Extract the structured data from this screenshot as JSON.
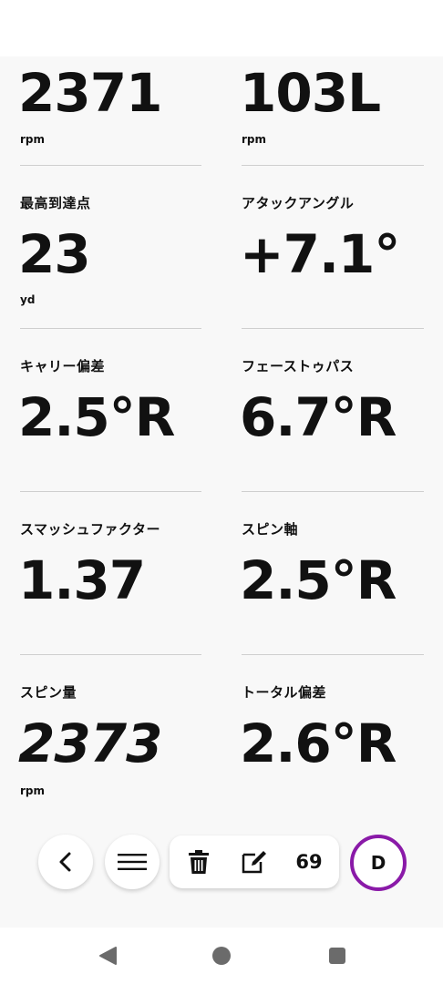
{
  "metrics": {
    "spin_top": {
      "value": "2371",
      "unit": "rpm"
    },
    "axis_top": {
      "value": "103L",
      "unit": "rpm"
    },
    "apex": {
      "label": "最高到達点",
      "value": "23",
      "unit": "yd"
    },
    "attack_angle": {
      "label": "アタックアングル",
      "value": "+7.1°"
    },
    "carry_dev": {
      "label": "キャリー偏差",
      "value": "2.5°R"
    },
    "face_to_path": {
      "label": "フェーストゥパス",
      "value": "6.7°R"
    },
    "smash": {
      "label": "スマッシュファクター",
      "value": "1.37"
    },
    "spin_axis": {
      "label": "スピン軸",
      "value": "2.5°R"
    },
    "spin_rate": {
      "label": "スピン量",
      "value": "2373",
      "unit": "rpm"
    },
    "total_dev": {
      "label": "トータル偏差",
      "value": "2.6°R"
    }
  },
  "toolbar": {
    "back_icon": "chevron-left-icon",
    "menu_icon": "hamburger-menu-icon",
    "delete_icon": "trash-icon",
    "edit_icon": "edit-icon",
    "shot_count": "69",
    "club_label": "D",
    "accent": "#8a1aa8"
  },
  "navbar": {
    "back_icon": "triangle-back-icon",
    "home_icon": "circle-home-icon",
    "recents_icon": "square-recents-icon"
  }
}
